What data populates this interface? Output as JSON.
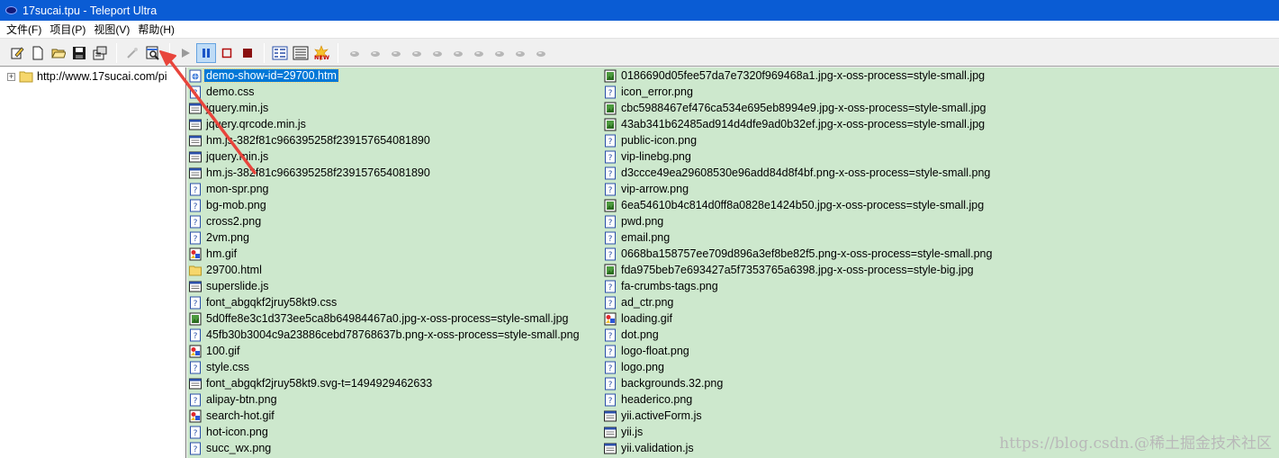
{
  "window": {
    "title": "17sucai.tpu - Teleport Ultra"
  },
  "menu": [
    "文件(F)",
    "项目(P)",
    "视图(V)",
    "帮助(H)"
  ],
  "toolbar": {
    "icons": [
      "edit-icon",
      "new-file-icon",
      "open-folder-icon",
      "save-icon",
      "properties-icon",
      "wizard-icon",
      "browse-files-icon",
      "play-icon",
      "pause-icon",
      "stop-icon",
      "stop-all-icon",
      "details-view-icon",
      "list-view-icon",
      "new-icon"
    ]
  },
  "tree": {
    "root_label": "http://www.17sucai.com/pi"
  },
  "files": {
    "left": [
      {
        "name": "demo-show-id=29700.htm",
        "type": "html",
        "selected": true
      },
      {
        "name": "demo.css",
        "type": "unknown"
      },
      {
        "name": "jquery.min.js",
        "type": "script"
      },
      {
        "name": "jquery.qrcode.min.js",
        "type": "script"
      },
      {
        "name": "hm.js-382f81c966395258f239157654081890",
        "type": "script"
      },
      {
        "name": "jquery.min.js",
        "type": "script"
      },
      {
        "name": "hm.js-382f81c966395258f239157654081890",
        "type": "script"
      },
      {
        "name": "mon-spr.png",
        "type": "unknown"
      },
      {
        "name": "bg-mob.png",
        "type": "unknown"
      },
      {
        "name": "cross2.png",
        "type": "unknown"
      },
      {
        "name": "2vm.png",
        "type": "unknown"
      },
      {
        "name": "hm.gif",
        "type": "gif"
      },
      {
        "name": "29700.html",
        "type": "folder"
      },
      {
        "name": "superslide.js",
        "type": "script"
      },
      {
        "name": "font_abgqkf2jruy58kt9.css",
        "type": "unknown"
      },
      {
        "name": "5d0ffe8e3c1d373ee5ca8b64984467a0.jpg-x-oss-process=style-small.jpg",
        "type": "jpg"
      },
      {
        "name": "45fb30b3004c9a23886cebd78768637b.png-x-oss-process=style-small.png",
        "type": "unknown"
      },
      {
        "name": "100.gif",
        "type": "gif"
      },
      {
        "name": "style.css",
        "type": "unknown"
      },
      {
        "name": "font_abgqkf2jruy58kt9.svg-t=1494929462633",
        "type": "script"
      },
      {
        "name": "alipay-btn.png",
        "type": "unknown"
      },
      {
        "name": "search-hot.gif",
        "type": "gif"
      },
      {
        "name": "hot-icon.png",
        "type": "unknown"
      },
      {
        "name": "succ_wx.png",
        "type": "unknown"
      }
    ],
    "right": [
      {
        "name": "0186690d05fee57da7e7320f969468a1.jpg-x-oss-process=style-small.jpg",
        "type": "jpg"
      },
      {
        "name": "icon_error.png",
        "type": "unknown"
      },
      {
        "name": "cbc5988467ef476ca534e695eb8994e9.jpg-x-oss-process=style-small.jpg",
        "type": "jpg"
      },
      {
        "name": "43ab341b62485ad914d4dfe9ad0b32ef.jpg-x-oss-process=style-small.jpg",
        "type": "jpg"
      },
      {
        "name": "public-icon.png",
        "type": "unknown"
      },
      {
        "name": "vip-linebg.png",
        "type": "unknown"
      },
      {
        "name": "d3ccce49ea29608530e96add84d8f4bf.png-x-oss-process=style-small.png",
        "type": "unknown"
      },
      {
        "name": "vip-arrow.png",
        "type": "unknown"
      },
      {
        "name": "6ea54610b4c814d0ff8a0828e1424b50.jpg-x-oss-process=style-small.jpg",
        "type": "jpg"
      },
      {
        "name": "pwd.png",
        "type": "unknown"
      },
      {
        "name": "email.png",
        "type": "unknown"
      },
      {
        "name": "0668ba158757ee709d896a3ef8be82f5.png-x-oss-process=style-small.png",
        "type": "unknown"
      },
      {
        "name": "fda975beb7e693427a5f7353765a6398.jpg-x-oss-process=style-big.jpg",
        "type": "jpg"
      },
      {
        "name": "fa-crumbs-tags.png",
        "type": "unknown"
      },
      {
        "name": "ad_ctr.png",
        "type": "unknown"
      },
      {
        "name": "loading.gif",
        "type": "gif"
      },
      {
        "name": "dot.png",
        "type": "unknown"
      },
      {
        "name": "logo-float.png",
        "type": "unknown"
      },
      {
        "name": "logo.png",
        "type": "unknown"
      },
      {
        "name": "backgrounds.32.png",
        "type": "unknown"
      },
      {
        "name": "headerico.png",
        "type": "unknown"
      },
      {
        "name": "yii.activeForm.js",
        "type": "script"
      },
      {
        "name": "yii.js",
        "type": "script"
      },
      {
        "name": "yii.validation.js",
        "type": "script"
      }
    ]
  },
  "watermark": "https://blog.csdn.@稀土掘金技术社区",
  "colors": {
    "titlebar": "#0a5cd4",
    "file_pane_bg": "#cde8cd",
    "selection": "#0078d7",
    "arrow": "#e8453c"
  }
}
